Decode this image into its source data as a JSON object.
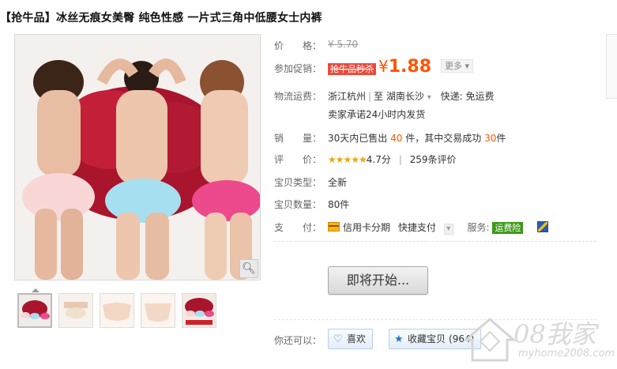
{
  "title": "【抢牛品】冰丝无痕女美臀 纯色性感 一片式三角中低腰女士内裤",
  "price": {
    "label": "价　　格：",
    "value": "¥ 5.70"
  },
  "promo": {
    "label": "参加促销：",
    "badge": "抢牛品秒杀",
    "symbol": "¥",
    "amount": "1.88",
    "more": "更多"
  },
  "shipping": {
    "label": "物流运费：",
    "from": "浙江杭州",
    "to_prefix": "至",
    "to": "湖南长沙",
    "express": "快递: 免运费",
    "promise": "卖家承诺24小时内发货"
  },
  "sales": {
    "label": "销　　量：",
    "text1": "30天内已售出",
    "sold": "40",
    "text2": "件，其中交易成功",
    "success": "30",
    "text3": "件"
  },
  "rating": {
    "label": "评　　价：",
    "stars": "★★★★★",
    "score": "4.7分",
    "sep": "|",
    "reviews": "259条评价"
  },
  "type": {
    "label": "宝贝类型：",
    "value": "全新"
  },
  "quantity": {
    "label": "宝贝数量：",
    "value": "80件"
  },
  "payment": {
    "label": "支　　付：",
    "credit": "信用卡分期",
    "quick": "快捷支付",
    "service_label": "服务:",
    "service_badge": "运费险"
  },
  "start_button": "即将开始...",
  "actions": {
    "label": "你还可以：",
    "like": "喜欢",
    "fav": "收藏宝贝",
    "fav_count": "(964)"
  },
  "watermark": {
    "main": "08我家",
    "sub": "myhome2008.com"
  },
  "colors": {
    "accent": "#ff5500",
    "promo": "#ea4a3a",
    "green": "#3a9a14",
    "link": "#2a79c8"
  }
}
